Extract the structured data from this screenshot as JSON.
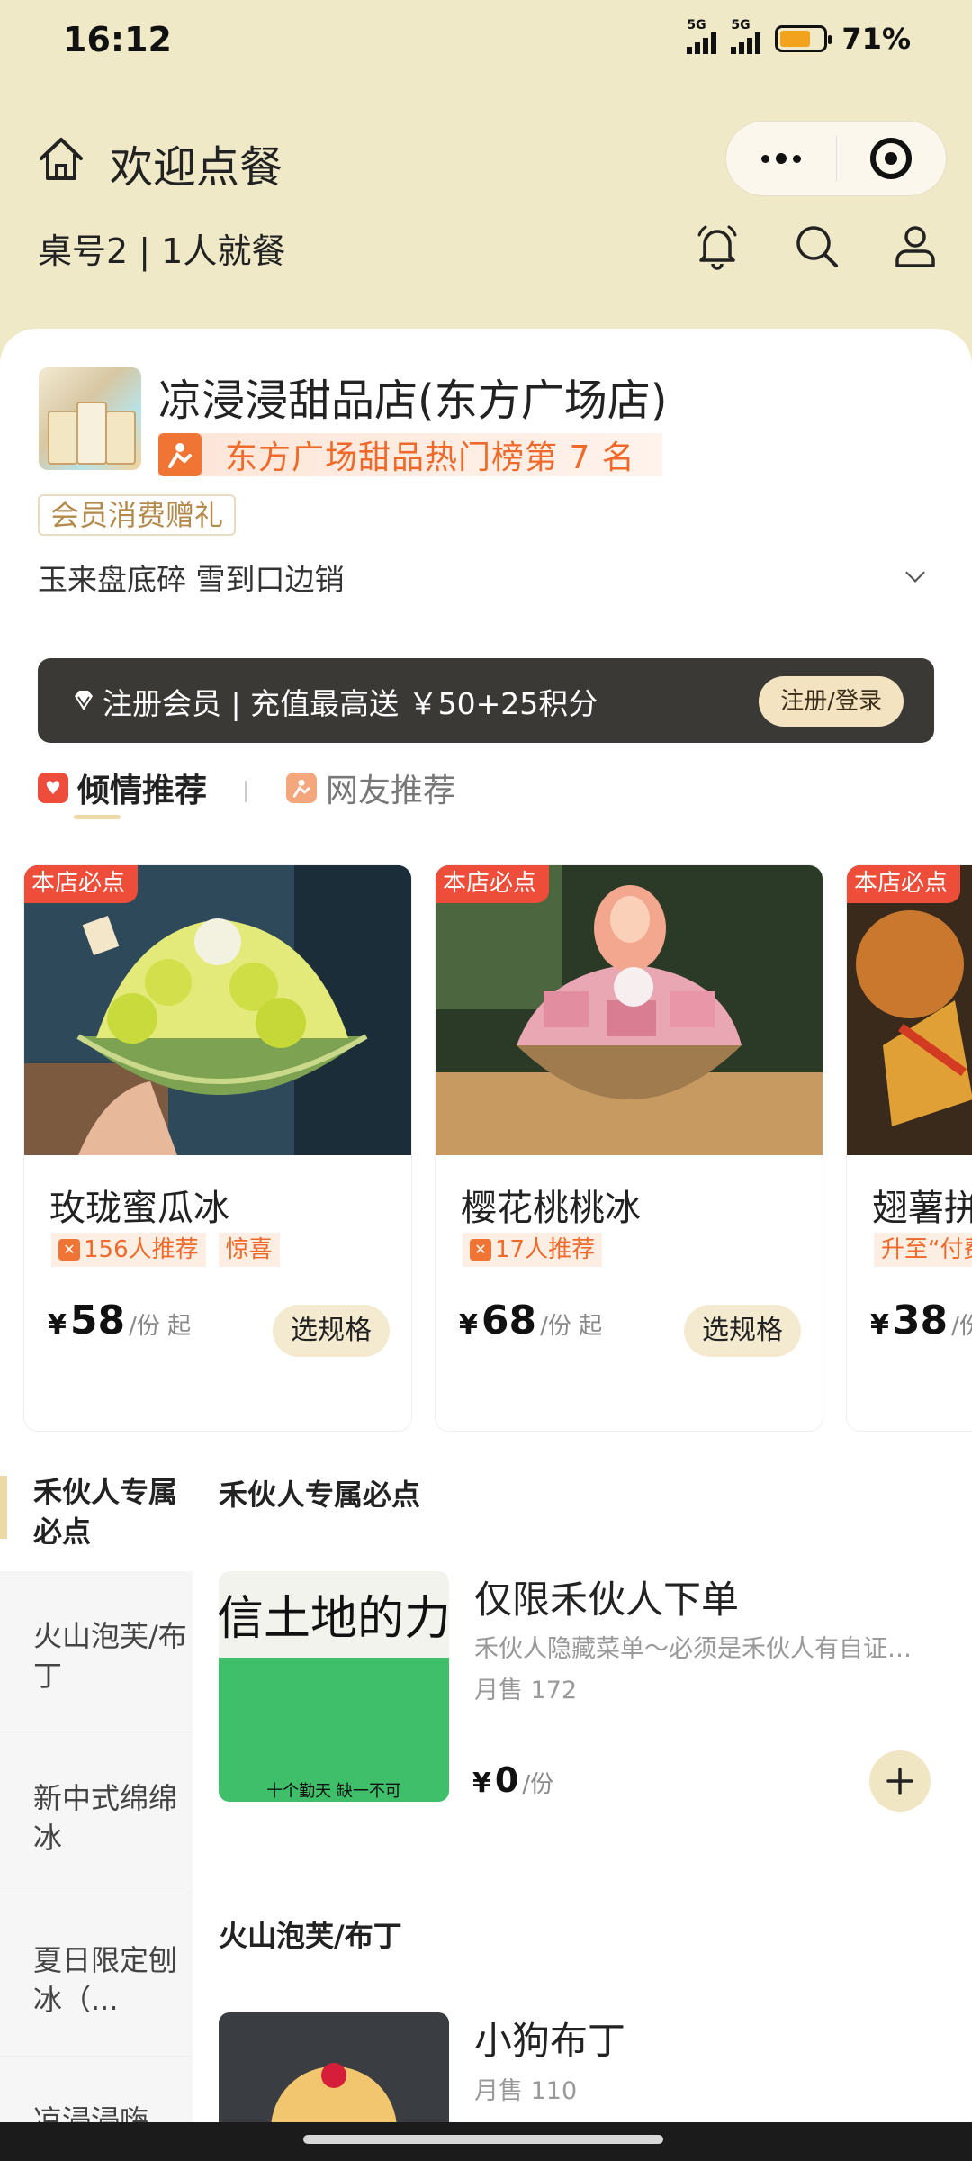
{
  "status": {
    "time": "16:12",
    "net1": "5G",
    "net2": "5G",
    "battery": "71%",
    "battery_level": 0.71
  },
  "nav": {
    "title": "欢迎点餐"
  },
  "table": {
    "info": "桌号2 | 1人就餐"
  },
  "store": {
    "name": "凉浸浸甜品店(东方广场店)",
    "rank": "东方广场甜品热门榜第 7 名",
    "member_tag": "会员消费赠礼",
    "promo": "玉来盘底碎 雪到口边销"
  },
  "member_bar": {
    "text": "注册会员 | 充值最高送 ￥50+25积分",
    "button": "注册/登录"
  },
  "rec_tabs": [
    "倾情推荐",
    "网友推荐"
  ],
  "recommend": [
    {
      "tag": "本店必点",
      "name": "玫珑蜜瓜冰",
      "badge1": "156人推荐",
      "badge2": "惊喜",
      "currency": "¥",
      "price": "58",
      "unit": "/份 起",
      "button": "选规格"
    },
    {
      "tag": "本店必点",
      "name": "樱花桃桃冰",
      "badge1": "17人推荐",
      "badge2": "",
      "currency": "¥",
      "price": "68",
      "unit": "/份 起",
      "button": "选规格"
    },
    {
      "tag": "本店必点",
      "name": "翅薯拼",
      "badge1": "升至“付费",
      "badge2": "",
      "currency": "¥",
      "price": "38",
      "unit": "/份",
      "button": ""
    }
  ],
  "sidebar": [
    {
      "label": "禾伙人专属必点"
    },
    {
      "label": "火山泡芙/布丁"
    },
    {
      "label": "新中式绵绵冰"
    },
    {
      "label": "夏日限定刨冰（..."
    },
    {
      "label": "凉浸浸嗨"
    }
  ],
  "sections": [
    {
      "title": "禾伙人专属必点",
      "item": {
        "name": "仅限禾伙人下单",
        "desc": "禾伙人隐藏菜单～必须是禾伙人有自证才...",
        "sales": "月售 172",
        "currency": "¥",
        "price": "0",
        "unit": "/份",
        "img_text": "“相信土地的力量”"
      }
    },
    {
      "title": "火山泡芙/布丁",
      "item": {
        "name": "小狗布丁",
        "sales": "月售 110"
      }
    }
  ]
}
